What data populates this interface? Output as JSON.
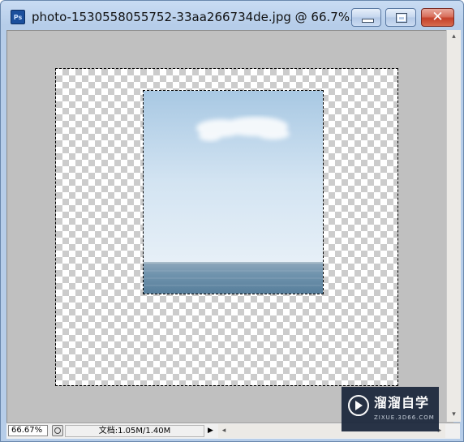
{
  "window": {
    "title": "photo-1530558055752-33aa266734de.jpg @ 66.7%...",
    "app_icon_text": "Ps",
    "minimize_icon": "minimize-icon",
    "maximize_icon": "maximize-icon",
    "close_label": "✕"
  },
  "statusbar": {
    "zoom": "66.67%",
    "doc_info": "文档:1.05M/1.40M",
    "arrow": "▶",
    "scroll_left": "◂",
    "scroll_right": "▸"
  },
  "vscroll": {
    "up": "▴",
    "down": "▾"
  },
  "watermark": {
    "title": "溜溜自学",
    "subtitle": "ZIXUE.3D66.COM"
  },
  "colors": {
    "canvas_bg": "#c0c0c0",
    "sky_top": "#a9c9e4",
    "sea": "#5f87a3"
  }
}
